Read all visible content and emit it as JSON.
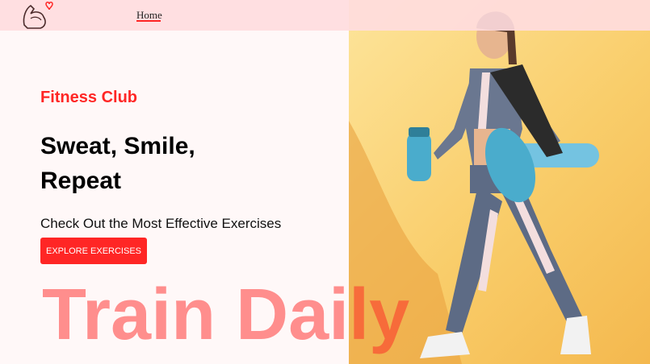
{
  "nav": {
    "home_label": "Home",
    "logo_icon": "flexed-bicep-heart-icon"
  },
  "hero": {
    "subtitle": "Fitness Club",
    "headline_line1": "Sweat, Smile,",
    "headline_line2": "Repeat",
    "tagline": "Check Out the Most Effective Exercises",
    "cta_label": "EXPLORE EXERCISES",
    "watermark": "Train Daily",
    "image_subject": "woman-walking-with-shaker-and-yoga-mat"
  },
  "colors": {
    "accent": "#ff2625",
    "navbar_bg": "#ffdcde",
    "page_bg": "#fff8f8",
    "hero_bg": "#f9cd6a"
  }
}
